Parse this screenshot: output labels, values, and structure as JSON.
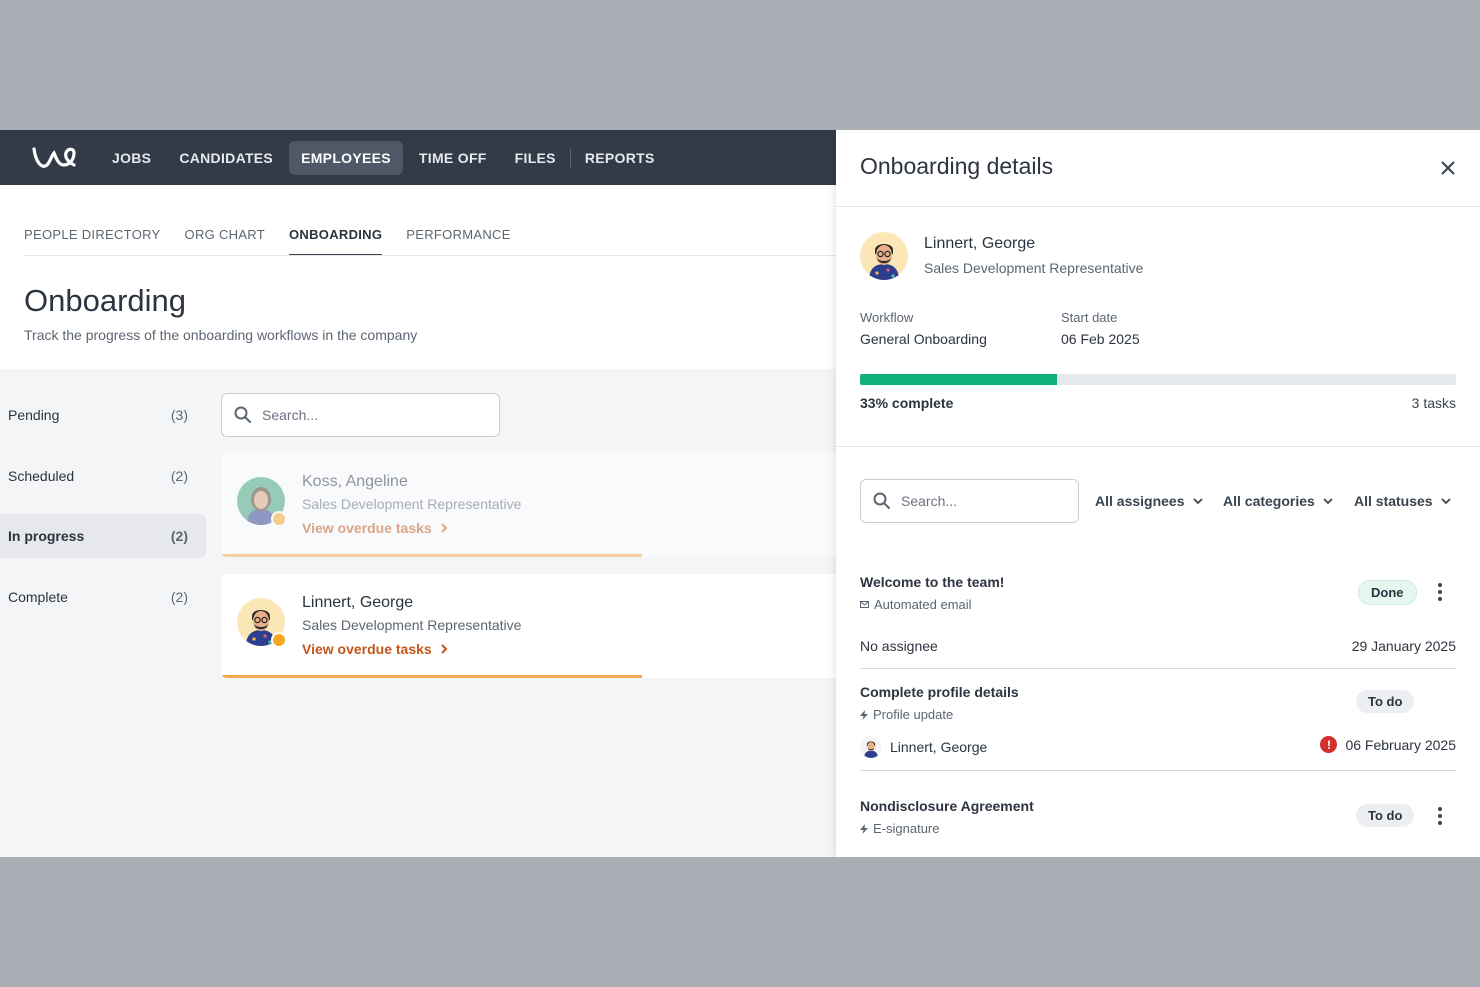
{
  "nav": {
    "items": [
      {
        "label": "JOBS"
      },
      {
        "label": "CANDIDATES"
      },
      {
        "label": "EMPLOYEES",
        "active": true
      },
      {
        "label": "TIME OFF"
      },
      {
        "label": "FILES"
      },
      {
        "label": "REPORTS"
      }
    ]
  },
  "subnav": {
    "tabs": [
      {
        "label": "PEOPLE DIRECTORY"
      },
      {
        "label": "ORG CHART"
      },
      {
        "label": "ONBOARDING",
        "active": true
      },
      {
        "label": "PERFORMANCE"
      }
    ]
  },
  "page": {
    "title": "Onboarding",
    "subtitle": "Track the progress of the onboarding workflows in the company"
  },
  "filters": [
    {
      "label": "Pending",
      "count": "(3)"
    },
    {
      "label": "Scheduled",
      "count": "(2)"
    },
    {
      "label": "In progress",
      "count": "(2)",
      "active": true
    },
    {
      "label": "Complete",
      "count": "(2)"
    }
  ],
  "search": {
    "placeholder": "Search..."
  },
  "employees": [
    {
      "name": "Koss, Angeline",
      "role": "Sales Development Representative",
      "link": "View overdue tasks",
      "progress": 0.33
    },
    {
      "name": "Linnert, George",
      "role": "Sales Development Representative",
      "link": "View overdue tasks",
      "progress": 0.33
    }
  ],
  "panel": {
    "title": "Onboarding details",
    "person": {
      "name": "Linnert, George",
      "role": "Sales Development Representative"
    },
    "workflow_label": "Workflow",
    "workflow_value": "General Onboarding",
    "start_label": "Start date",
    "start_value": "06 Feb 2025",
    "progress": 0.33,
    "complete_text": "33% complete",
    "tasks_text": "3 tasks",
    "search_placeholder": "Search...",
    "filters": {
      "assignees": "All assignees",
      "categories": "All categories",
      "statuses": "All statuses"
    },
    "tasks": [
      {
        "title": "Welcome to the team!",
        "type": "Automated email",
        "status": "Done",
        "assignee": "No assignee",
        "date": "29 January 2025"
      },
      {
        "title": "Complete profile details",
        "type": "Profile update",
        "status": "To do",
        "assignee": "Linnert, George",
        "date": "06 February 2025",
        "overdue": true
      },
      {
        "title": "Nondisclosure Agreement",
        "type": "E-signature",
        "status": "To do"
      }
    ]
  },
  "colors": {
    "nav_bg": "#323b47",
    "accent_orange": "#c1561b",
    "progress_green": "#12b07b",
    "progress_orange": "#f5a84a",
    "alert_red": "#d32f2f"
  }
}
